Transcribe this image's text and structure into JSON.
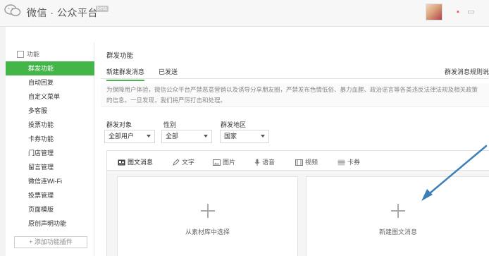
{
  "header": {
    "brand": "微信 · 公众平台",
    "beta": "beta"
  },
  "sidebar": {
    "heading": "功能",
    "items": [
      {
        "label": "群发功能",
        "active": true
      },
      {
        "label": "自动回复"
      },
      {
        "label": "自定义菜单"
      },
      {
        "label": "多客服"
      },
      {
        "label": "投票功能"
      },
      {
        "label": "卡券功能"
      },
      {
        "label": "门店管理"
      },
      {
        "label": "留言管理"
      },
      {
        "label": "微信连Wi-Fi"
      },
      {
        "label": "投票管理"
      },
      {
        "label": "页面模版"
      },
      {
        "label": "原创声明功能"
      }
    ],
    "add_plugin": "+ 添加功能插件"
  },
  "main": {
    "title": "群发功能",
    "tabs": [
      {
        "label": "新建群发消息",
        "active": true
      },
      {
        "label": "已发送"
      }
    ],
    "rules_link": "群发消息规则说",
    "notice": "为保障用户体验，微信公众平台严禁恶意营销以及诱导分享朋友圈，严禁发布色情低俗、暴力血腥、政治谣言等各类违反法律法规及相关政策的信息。一旦发现，我们将严厉打击和处理。",
    "filters": [
      {
        "label": "群发对象",
        "value": "全部用户"
      },
      {
        "label": "性别",
        "value": "全部"
      },
      {
        "label": "群发地区",
        "value": "国家"
      }
    ],
    "toolbar": [
      {
        "label": "图文消息",
        "icon": "news-icon",
        "active": true
      },
      {
        "label": "文字",
        "icon": "pencil-icon"
      },
      {
        "label": "图片",
        "icon": "image-icon"
      },
      {
        "label": "语音",
        "icon": "microphone-icon"
      },
      {
        "label": "视频",
        "icon": "video-icon"
      },
      {
        "label": "卡券",
        "icon": "card-icon"
      }
    ],
    "cards": [
      {
        "label": "从素材库中选择"
      },
      {
        "label": "新建图文消息"
      }
    ]
  },
  "colors": {
    "accent": "#44b549",
    "arrow": "#3d7fb7"
  }
}
